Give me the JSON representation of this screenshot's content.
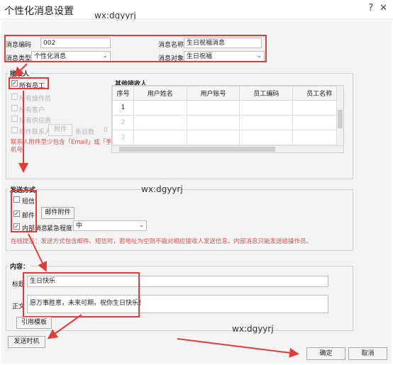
{
  "window": {
    "title": "个性化消息设置",
    "help_icon": "help-circle-icon",
    "close_icon": "close-icon",
    "watermark": "wx:dgyyrj"
  },
  "header_fields": {
    "code_label": "消息编码",
    "code_value": "002",
    "name_label": "消息名称",
    "name_value": "生日祝福消息",
    "type_label": "消息类型",
    "type_value": "个性化消息",
    "target_label": "消息对象",
    "target_value": "生日祝福"
  },
  "recipients": {
    "group_title": "接收人",
    "all_employees": "所有员工",
    "all_operators": "所有操作员",
    "all_customers": "所有客户",
    "all_suppliers": "所有供应商",
    "attach_contacts": "附件联系人",
    "attach_button": "附件",
    "item_count_label": "条目数",
    "item_count": "0",
    "note_line1": "联系人附件至少包含「Email」或「手",
    "note_line2": "机号",
    "others_title": "其他接收人",
    "columns": [
      "序号",
      "用户姓名",
      "用户账号",
      "员工编码",
      "员工名称"
    ],
    "rows": [
      "1",
      "2",
      "3"
    ]
  },
  "send_method": {
    "group_title": "发送方式",
    "sms": "短信",
    "email": "邮件",
    "email_attach_button": "邮件附件",
    "internal": "内部消息",
    "urgency_label": "紧急程度",
    "urgency_value": "中",
    "tip": "在线提示：发送方式包含邮件、短信时，若地址为空则不能对相应接收人发送信息。内部消息只能发送给操作员。"
  },
  "content": {
    "group_title": "内容：",
    "subject_label": "标题",
    "subject_value": "生日快乐",
    "body_label": "正文",
    "body_value": "愿万事胜意，未来可期，祝你生日快乐！",
    "template_button": "引用模板"
  },
  "footer": {
    "send_time_button": "发送时机",
    "ok_button": "确定",
    "cancel_button": "取消"
  },
  "accent_color": "#e03c3c"
}
